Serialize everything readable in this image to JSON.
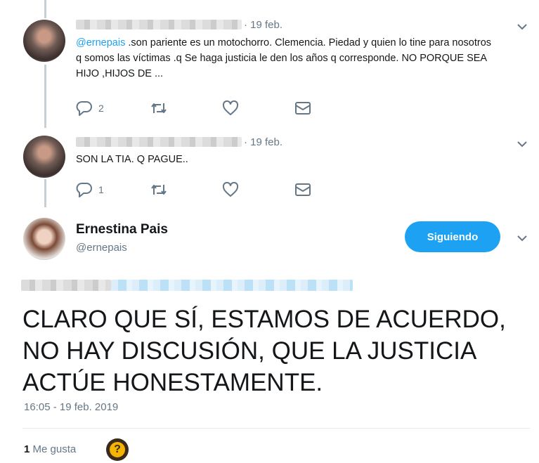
{
  "replies": [
    {
      "date": "· 19 feb.",
      "mention": "@ernepais",
      "text": " .son pariente es un motochorro. Clemencia.  Piedad y quien lo tine para nosotros q somos las víctimas .q Se haga justicia  le den los años q corresponde. NO PORQUE SEA HIJO ,HIJOS DE ...",
      "reply_count": "2",
      "retweet_count": "",
      "like_count": ""
    },
    {
      "date": "· 19 feb.",
      "text": "SON LA TIA. Q PAGUE..",
      "reply_count": "1",
      "retweet_count": "",
      "like_count": ""
    }
  ],
  "main_tweet": {
    "name": "Ernestina Pais",
    "handle": "@ernepais",
    "follow_label": "Siguiendo",
    "text": "CLARO QUE SÍ, ESTAMOS DE ACUERDO, NO HAY DISCUSIÓN, QUE LA JUSTICIA ACTÚE HONESTAMENTE.",
    "timestamp": "16:05 - 19 feb. 2019",
    "like_count": "1",
    "like_label": "Me gusta"
  },
  "icons": {
    "reply": "reply-icon",
    "retweet": "retweet-icon",
    "like": "heart-icon",
    "dm": "envelope-icon",
    "more": "chevron-down-icon"
  },
  "colors": {
    "accent": "#1da1f2",
    "muted": "#657786",
    "text": "#14171a"
  }
}
